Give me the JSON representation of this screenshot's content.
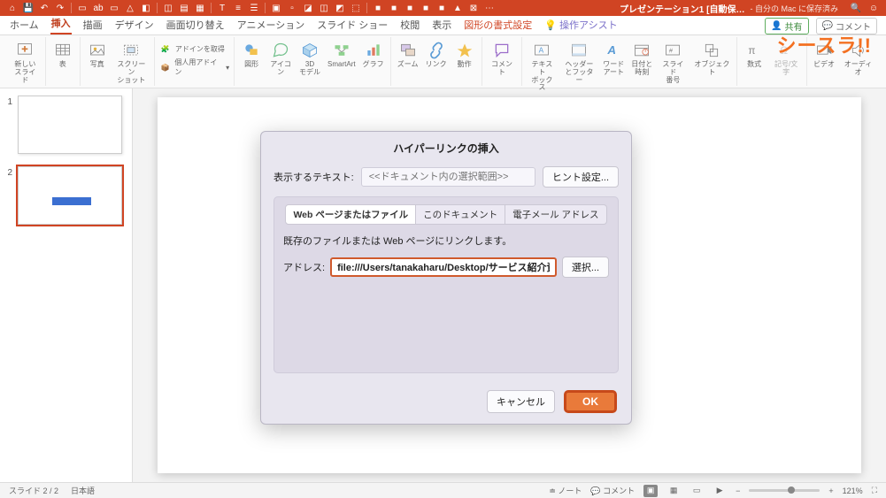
{
  "qat": {
    "doc_title": "プレゼンテーション1 [自動保…",
    "save_location": "- 自分の Mac に保存済み"
  },
  "tabs": {
    "items": [
      "ホーム",
      "挿入",
      "描画",
      "デザイン",
      "画面切り替え",
      "アニメーション",
      "スライド ショー",
      "校閲",
      "表示"
    ],
    "contextual": "図形の書式設定",
    "extra": "操作アシスト",
    "active_index": 1,
    "share": "共有",
    "comment": "コメント"
  },
  "ribbon": {
    "new_slide": "新しい\nスライド",
    "table": "表",
    "photo": "写真",
    "screenshot": "スクリーン\nショット",
    "addin_get": "アドインを取得",
    "addin_my": "個人用アドイン",
    "shapes": "図形",
    "icons": "アイコン",
    "model3d": "3D\nモデル",
    "smartart": "SmartArt",
    "chart": "グラフ",
    "zoom": "ズーム",
    "link": "リンク",
    "action": "動作",
    "comment": "コメント",
    "textbox": "テキスト\nボックス",
    "headerfooter": "ヘッダー\nとフッター",
    "wordart": "ワード\nアート",
    "datetime": "日付と\n時刻",
    "slidenumber": "スライド\n番号",
    "object": "オブジェクト",
    "equation": "数式",
    "symbol": "記号/文字",
    "video": "ビデオ",
    "audio": "オーディオ"
  },
  "thumbs": {
    "slide1_num": "1",
    "slide2_num": "2"
  },
  "dialog": {
    "title": "ハイパーリンクの挿入",
    "display_label": "表示するテキスト:",
    "display_placeholder": "<<ドキュメント内の選択範囲>>",
    "hint_btn": "ヒント設定...",
    "seg": [
      "Web ページまたはファイル",
      "このドキュメント",
      "電子メール アドレス"
    ],
    "seg_active": 0,
    "panel_text": "既存のファイルまたは Web ページにリンクします。",
    "addr_label": "アドレス:",
    "addr_value": "file:///Users/tanakaharu/Desktop/サービス紹介資料.p",
    "select_btn": "選択...",
    "cancel": "キャンセル",
    "ok": "OK"
  },
  "status": {
    "slide_pos": "スライド 2 / 2",
    "lang": "日本語",
    "notes": "ノート",
    "comments": "コメント",
    "zoom": "121%"
  },
  "watermark": "シースラ!!"
}
